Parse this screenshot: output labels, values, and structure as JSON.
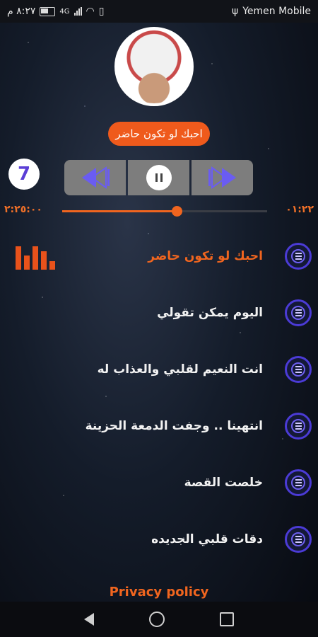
{
  "status_bar": {
    "time": "٨:٢٧ م",
    "carrier": "Yemen Mobile",
    "network_type": "4G",
    "icons": [
      "battery-icon",
      "signal-icon",
      "wifi-icon",
      "vibrate-icon"
    ]
  },
  "player": {
    "now_playing_title": "احبك لو تكون حاضر",
    "badge_glyph": "7",
    "elapsed_time": "٠١:٢٢",
    "total_time": "٢:٢٥:٠٠",
    "progress_fraction": 0.56,
    "accent_color": "#f0651f",
    "controls": {
      "prev_icon": "previous-icon",
      "pause_icon": "pause-icon",
      "next_icon": "next-icon"
    }
  },
  "songs": [
    {
      "title": "احبك لو تكون حاضر",
      "active": true
    },
    {
      "title": "اليوم يمكن تقولي",
      "active": false
    },
    {
      "title": "انت النعيم لقلبي والعذاب له",
      "active": false
    },
    {
      "title": "انتهينا .. وجفت الدمعة الحزينة",
      "active": false
    },
    {
      "title": "خلصت القصة",
      "active": false
    },
    {
      "title": "دقات قلبي الجديده",
      "active": false
    }
  ],
  "footer": {
    "privacy_label": "Privacy policy"
  }
}
